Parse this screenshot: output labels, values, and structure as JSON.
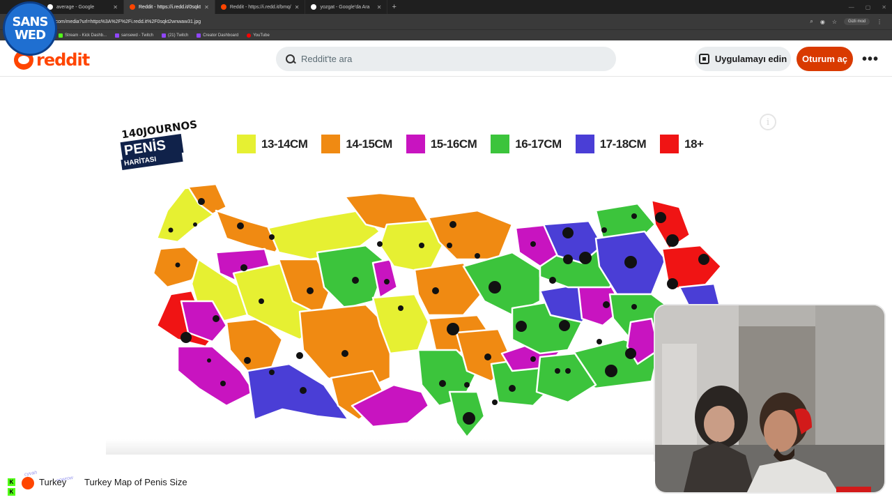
{
  "browser": {
    "tabs": [
      {
        "label": "average - Google",
        "active": false
      },
      {
        "label": "Reddit - https://i.redd.it/0sqkt",
        "active": true
      },
      {
        "label": "Reddit - https://i.redd.it/bmq/",
        "active": false
      },
      {
        "label": "yozgat - Google'da Ara",
        "active": false
      }
    ],
    "new_tab": "+",
    "url": "reddit.com/media?url=https%3A%2F%2Fi.redd.it%2F0sqkt2wnwaw31.jpg",
    "incognito_label": "Gizli mod",
    "bookmarks": [
      {
        "label": "Stream - Kick Dashb...",
        "icon": "kick-icon"
      },
      {
        "label": "sansewd - Twitch",
        "icon": "twitch-icon"
      },
      {
        "label": "(21) Twitch",
        "icon": "twitch-icon"
      },
      {
        "label": "Creator Dashboard",
        "icon": "twitch-icon"
      },
      {
        "label": "YouTube",
        "icon": "youtube-icon"
      }
    ]
  },
  "stream_logo": {
    "line1": "SANS",
    "line2": "WED"
  },
  "reddit": {
    "logo_text": "reddit",
    "search_placeholder": "Reddit'te ara",
    "get_app_label": "Uygulamayı edin",
    "login_label": "Oturum aç",
    "more_label": "•••",
    "accent": "#ff4500"
  },
  "media": {
    "brand_line1": "140JOURNOS",
    "brand_line2": "PENİS",
    "brand_line3": "HARİTASI",
    "info_icon": "i",
    "legend": [
      {
        "label": "13-14CM",
        "color": "#e6f032"
      },
      {
        "label": "14-15CM",
        "color": "#f08a12"
      },
      {
        "label": "15-16CM",
        "color": "#c814c0"
      },
      {
        "label": "16-17CM",
        "color": "#3cc43c"
      },
      {
        "label": "17-18CM",
        "color": "#4a3ed6"
      },
      {
        "label": "18+",
        "color": "#f01414"
      }
    ]
  },
  "footer": {
    "title": "Turkey Map of Penis Size",
    "truncated_title": "Turkey",
    "overlay_text1": "cyvah",
    "overlay_text2": "nowrow"
  }
}
